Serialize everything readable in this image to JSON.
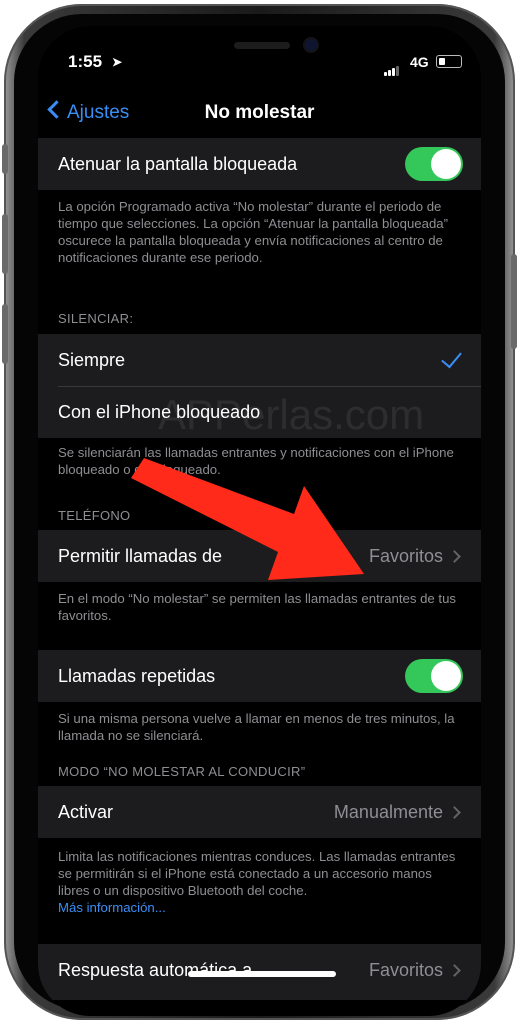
{
  "status_bar": {
    "time": "1:55",
    "network": "4G"
  },
  "nav": {
    "back_label": "Ajustes",
    "title": "No molestar"
  },
  "dim_lock": {
    "label": "Atenuar la pantalla bloqueada",
    "enabled": true,
    "footer": "La opción Programado activa “No molestar” durante el periodo de tiempo que selecciones. La opción “Atenuar la pantalla bloqueada” oscurece la pantalla bloqueada y envía notificaciones al centro de notificaciones durante ese periodo."
  },
  "silence": {
    "header": "SILENCIAR:",
    "options": [
      "Siempre",
      "Con el iPhone bloqueado"
    ],
    "selected": "Siempre",
    "footer": "Se silenciarán las llamadas entrantes y notificaciones con el iPhone bloqueado o desbloqueado."
  },
  "watermark": "APPerlas.com",
  "phone": {
    "header": "TELÉFONO",
    "allow_calls_label": "Permitir llamadas de",
    "allow_calls_value": "Favoritos",
    "footer": "En el modo “No molestar” se permiten las llamadas entrantes de tus favoritos."
  },
  "repeated": {
    "label": "Llamadas repetidas",
    "enabled": true,
    "footer": "Si una misma persona vuelve a llamar en menos de tres minutos, la llamada no se silenciará."
  },
  "driving": {
    "header": "MODO “NO MOLESTAR AL CONDUCIR”",
    "activate_label": "Activar",
    "activate_value": "Manualmente",
    "footer": "Limita las notificaciones mientras conduces. Las llamadas entrantes se permitirán si el iPhone está conectado a un accesorio manos libres o un dispositivo Bluetooth del coche.",
    "more_link": "Más información..."
  },
  "auto_reply": {
    "label": "Respuesta automática a",
    "value": "Favoritos"
  },
  "colors": {
    "accent": "#3a8ef6",
    "toggle_on": "#34c759",
    "arrow": "#ff2a1a",
    "cell_bg": "#1c1c1e"
  }
}
